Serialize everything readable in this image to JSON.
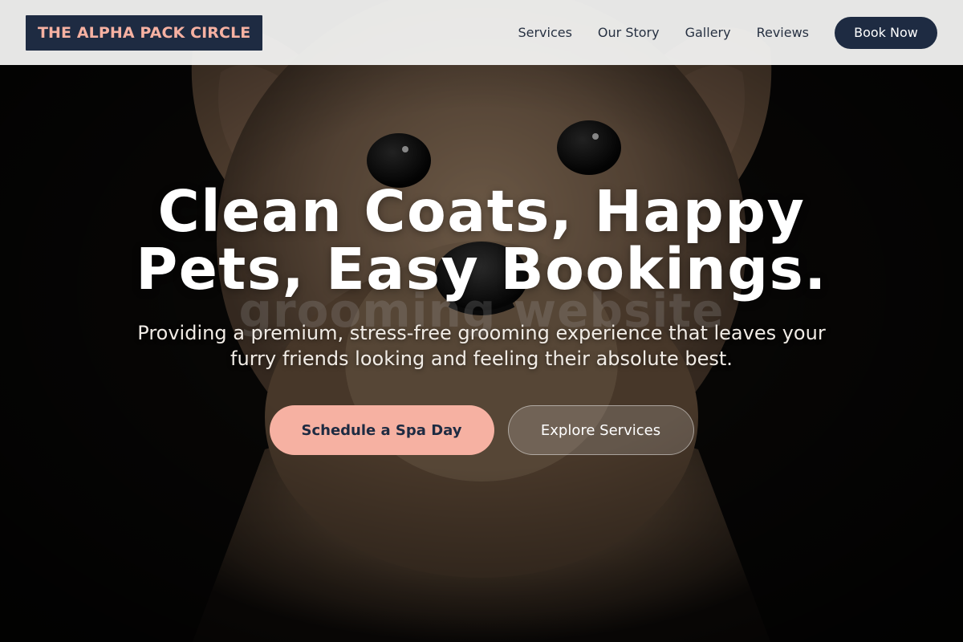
{
  "header": {
    "logo_text": "THE ALPHA PACK CIRCLE",
    "nav": [
      {
        "label": "Services"
      },
      {
        "label": "Our Story"
      },
      {
        "label": "Gallery"
      },
      {
        "label": "Reviews"
      }
    ],
    "book_label": "Book Now"
  },
  "hero": {
    "title": "Clean Coats, Happy Pets, Easy Bookings.",
    "watermark": "grooming website",
    "subtitle": "Providing a premium, stress-free grooming experience that leaves your furry friends looking and feeling their absolute best.",
    "primary_cta": "Schedule a Spa Day",
    "secondary_cta": "Explore Services",
    "background_image": "yorkshire-terrier-photo"
  },
  "colors": {
    "navy": "#1e2b42",
    "peach": "#f6b1a2",
    "header_bg": "#f4f4f3",
    "hero_dark": "#0c0a09"
  }
}
